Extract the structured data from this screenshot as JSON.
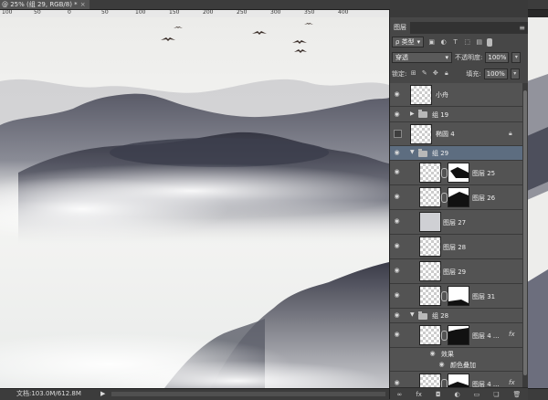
{
  "document_tab": {
    "title": "@ 25% (组 29, RGB/8) *",
    "close": "×"
  },
  "ruler": {
    "ticks": [
      "100",
      "50",
      "0",
      "50",
      "100",
      "150",
      "200",
      "250",
      "300",
      "350",
      "400"
    ]
  },
  "status_bar": {
    "doc_info": "文档:103.0M/612.8M",
    "arrow": "▶"
  },
  "layers_panel": {
    "tab_label": "图层",
    "menu_icon": "≡",
    "filter": {
      "label": "ρ 类型",
      "icons": [
        "image-filter-icon",
        "adjustment-filter-icon",
        "type-filter-icon",
        "shape-filter-icon",
        "smart-object-filter-icon"
      ]
    },
    "blend_mode": "穿透",
    "opacity_label": "不透明度:",
    "opacity_value": "100%",
    "lock_label": "锁定:",
    "fill_label": "填充:",
    "fill_value": "100%",
    "layers": [
      {
        "name": "小舟",
        "visible": true,
        "kind": "layer"
      },
      {
        "name": "组 19",
        "visible": true,
        "kind": "group",
        "expanded": false
      },
      {
        "name": "椭圆 4",
        "visible": false,
        "kind": "shape",
        "locked": true
      },
      {
        "name": "组 29",
        "visible": true,
        "kind": "group",
        "expanded": true,
        "selected": true
      },
      {
        "name": "图层 25",
        "visible": true,
        "kind": "layer",
        "mask": true
      },
      {
        "name": "图层 26",
        "visible": true,
        "kind": "layer",
        "mask": true
      },
      {
        "name": "图层 27",
        "visible": true,
        "kind": "layer"
      },
      {
        "name": "图层 28",
        "visible": true,
        "kind": "layer"
      },
      {
        "name": "图层 29",
        "visible": true,
        "kind": "layer"
      },
      {
        "name": "图层 31",
        "visible": true,
        "kind": "layer",
        "mask": true
      },
      {
        "name": "组 28",
        "visible": true,
        "kind": "group",
        "expanded": true
      },
      {
        "name": "图层 4 ...",
        "visible": true,
        "kind": "layer",
        "mask": true,
        "fx": true
      },
      {
        "name": "效果",
        "visible": true,
        "kind": "effects"
      },
      {
        "name": "颜色叠加",
        "visible": true,
        "kind": "effect"
      },
      {
        "name": "图层 4 ...",
        "visible": true,
        "kind": "layer",
        "mask": true,
        "fx": true
      }
    ],
    "fx_label": "fx",
    "footer_icons": [
      "link-layers-icon",
      "add-style-icon",
      "add-mask-icon",
      "adjustment-layer-icon",
      "new-group-icon",
      "new-layer-icon",
      "delete-layer-icon"
    ]
  },
  "colors": {
    "panel_bg": "#535353",
    "selected_row": "#5d6d80",
    "canvas_mist": "#f2f2f1",
    "mountain_dark": "#3c3e4c"
  }
}
